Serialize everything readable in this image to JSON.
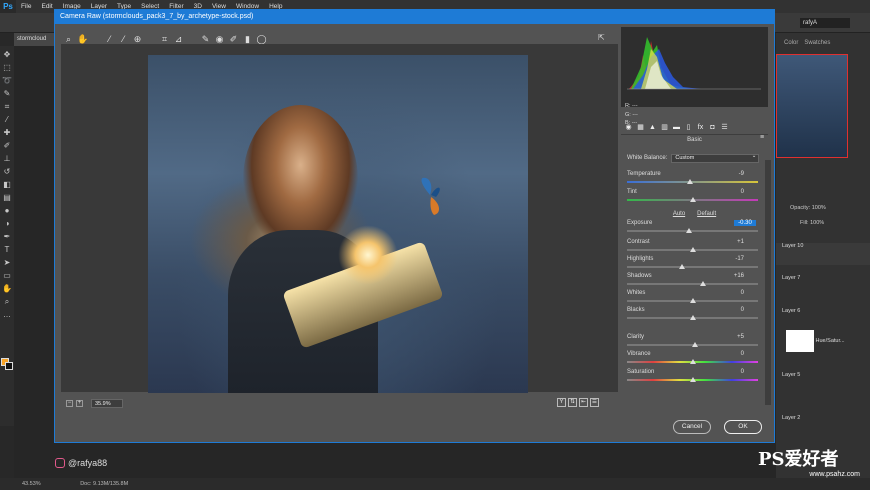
{
  "ps": {
    "logo": "Ps",
    "menu": [
      "File",
      "Edit",
      "Image",
      "Layer",
      "Type",
      "Select",
      "Filter",
      "3D",
      "View",
      "Window",
      "Help"
    ],
    "doc_tab": "stormcloud",
    "user": "rafyA",
    "right_tabs": [
      "Color",
      "Swatches"
    ],
    "layers": [
      "Layer 10",
      "Layer 7",
      "Layer 6",
      "Hue/Satur...",
      "Layer 5",
      "Layer 2"
    ],
    "opacity": "100%",
    "fill": "100%",
    "status_zoom": "43.53%",
    "status_doc": "Doc: 9.13M/135.8M",
    "fg_color": "#f7a327"
  },
  "cr": {
    "title": "Camera Raw (stormclouds_pack3_7_by_archetype-stock.psd)",
    "zoom": "35.9%",
    "rgb": {
      "r": "R:   ---",
      "g": "G:   ---",
      "b": "B:   ---"
    },
    "panel_title": "Basic",
    "wb_label": "White Balance:",
    "wb_value": "Custom",
    "auto_label": "Auto",
    "default_label": "Default",
    "sliders": [
      {
        "name": "Temperature",
        "value": "-9",
        "pos": 0.48
      },
      {
        "name": "Tint",
        "value": "0",
        "pos": 0.5
      },
      {
        "name": "Exposure",
        "value": "-0.30",
        "pos": 0.47,
        "highlight": true
      },
      {
        "name": "Contrast",
        "value": "+1",
        "pos": 0.5
      },
      {
        "name": "Highlights",
        "value": "-17",
        "pos": 0.42
      },
      {
        "name": "Shadows",
        "value": "+16",
        "pos": 0.58
      },
      {
        "name": "Whites",
        "value": "0",
        "pos": 0.5
      },
      {
        "name": "Blacks",
        "value": "0",
        "pos": 0.5
      },
      {
        "name": "Clarity",
        "value": "+5",
        "pos": 0.52
      },
      {
        "name": "Vibrance",
        "value": "0",
        "pos": 0.5
      },
      {
        "name": "Saturation",
        "value": "0",
        "pos": 0.5
      }
    ],
    "cancel_label": "Cancel",
    "ok_label": "OK",
    "accent": "#1e7bd6"
  },
  "watermark": {
    "user": "@rafya88",
    "site": "PS爱好者",
    "url": "www.psahz.com"
  }
}
